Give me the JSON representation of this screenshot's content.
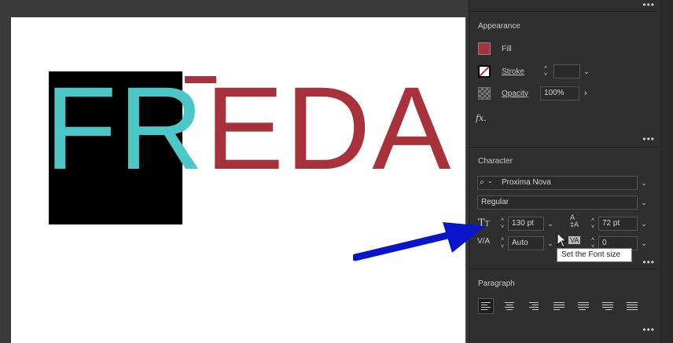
{
  "artboard": {
    "word_letters": [
      "F",
      "R",
      "E",
      "D",
      "A"
    ]
  },
  "appearance": {
    "title": "Appearance",
    "fill_label": "Fill",
    "stroke_label": "Stroke",
    "opacity_label": "Opacity",
    "opacity_value": "100%",
    "fx_label": "fx."
  },
  "character": {
    "title": "Character",
    "font_family": "Proxima Nova",
    "font_style": "Regular",
    "font_size": "130 pt",
    "leading": "72 pt",
    "kerning": "Auto",
    "tracking": "0",
    "tooltip": "Set the Font size"
  },
  "paragraph": {
    "title": "Paragraph"
  },
  "colors": {
    "teal": "#4cc6c6",
    "red": "#a8323b",
    "panel_bg": "#2f2f2f",
    "arrow": "#0a14c8"
  },
  "icons": [
    "search-icon",
    "chevron-down-icon",
    "font-size-icon",
    "leading-icon",
    "kerning-icon",
    "tracking-icon",
    "fx-icon",
    "more-icon",
    "cursor-icon"
  ]
}
